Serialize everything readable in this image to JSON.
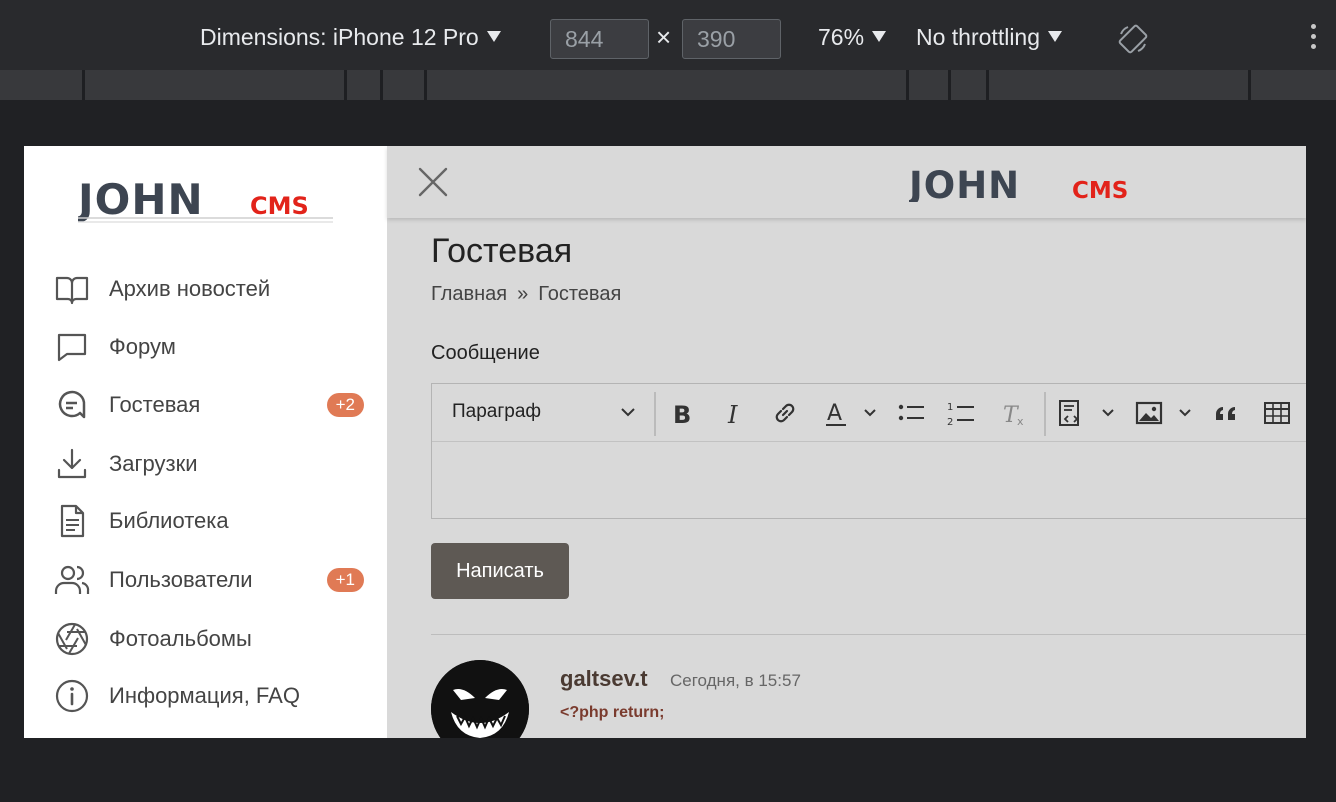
{
  "devtools": {
    "dimensions_label": "Dimensions: iPhone 12 Pro",
    "width_value": "844",
    "height_value": "390",
    "times_sign": "×",
    "zoom": "76%",
    "throttling": "No throttling",
    "icons": [
      "dropdown-triangle-icon",
      "rotate-icon",
      "more-vertical-icon"
    ]
  },
  "sidebar": {
    "logo": {
      "text_main": "JOHN",
      "text_accent": "CMS",
      "accent_color": "#e2231a",
      "main_color": "#3d4551"
    },
    "items": [
      {
        "label": "Архив новостей",
        "icon": "book-icon",
        "badge": ""
      },
      {
        "label": "Форум",
        "icon": "chat-bubble-icon",
        "badge": ""
      },
      {
        "label": "Гостевая",
        "icon": "guestbook-icon",
        "badge": "+2"
      },
      {
        "label": "Загрузки",
        "icon": "download-icon",
        "badge": ""
      },
      {
        "label": "Библиотека",
        "icon": "document-icon",
        "badge": ""
      },
      {
        "label": "Пользователи",
        "icon": "users-icon",
        "badge": "+1"
      },
      {
        "label": "Фотоальбомы",
        "icon": "aperture-icon",
        "badge": ""
      },
      {
        "label": "Информация, FAQ",
        "icon": "info-icon",
        "badge": ""
      }
    ],
    "badge_color": "#e07a55"
  },
  "main": {
    "page_title": "Гостевая",
    "breadcrumb": {
      "home": "Главная",
      "separator": "»",
      "current": "Гостевая"
    },
    "message_label": "Сообщение",
    "editor": {
      "paragraph_select": "Параграф",
      "tools": [
        "bold-icon",
        "italic-icon",
        "link-icon",
        "font-color-icon",
        "bulleted-list-icon",
        "numbered-list-icon",
        "remove-format-icon",
        "source-code-icon",
        "image-icon",
        "blockquote-icon",
        "table-icon"
      ]
    },
    "submit_label": "Написать",
    "submit_color": "#5e5954",
    "post": {
      "author": "galtsev.t",
      "time": "Сегодня, в 15:57",
      "text": "<?php return;"
    }
  }
}
